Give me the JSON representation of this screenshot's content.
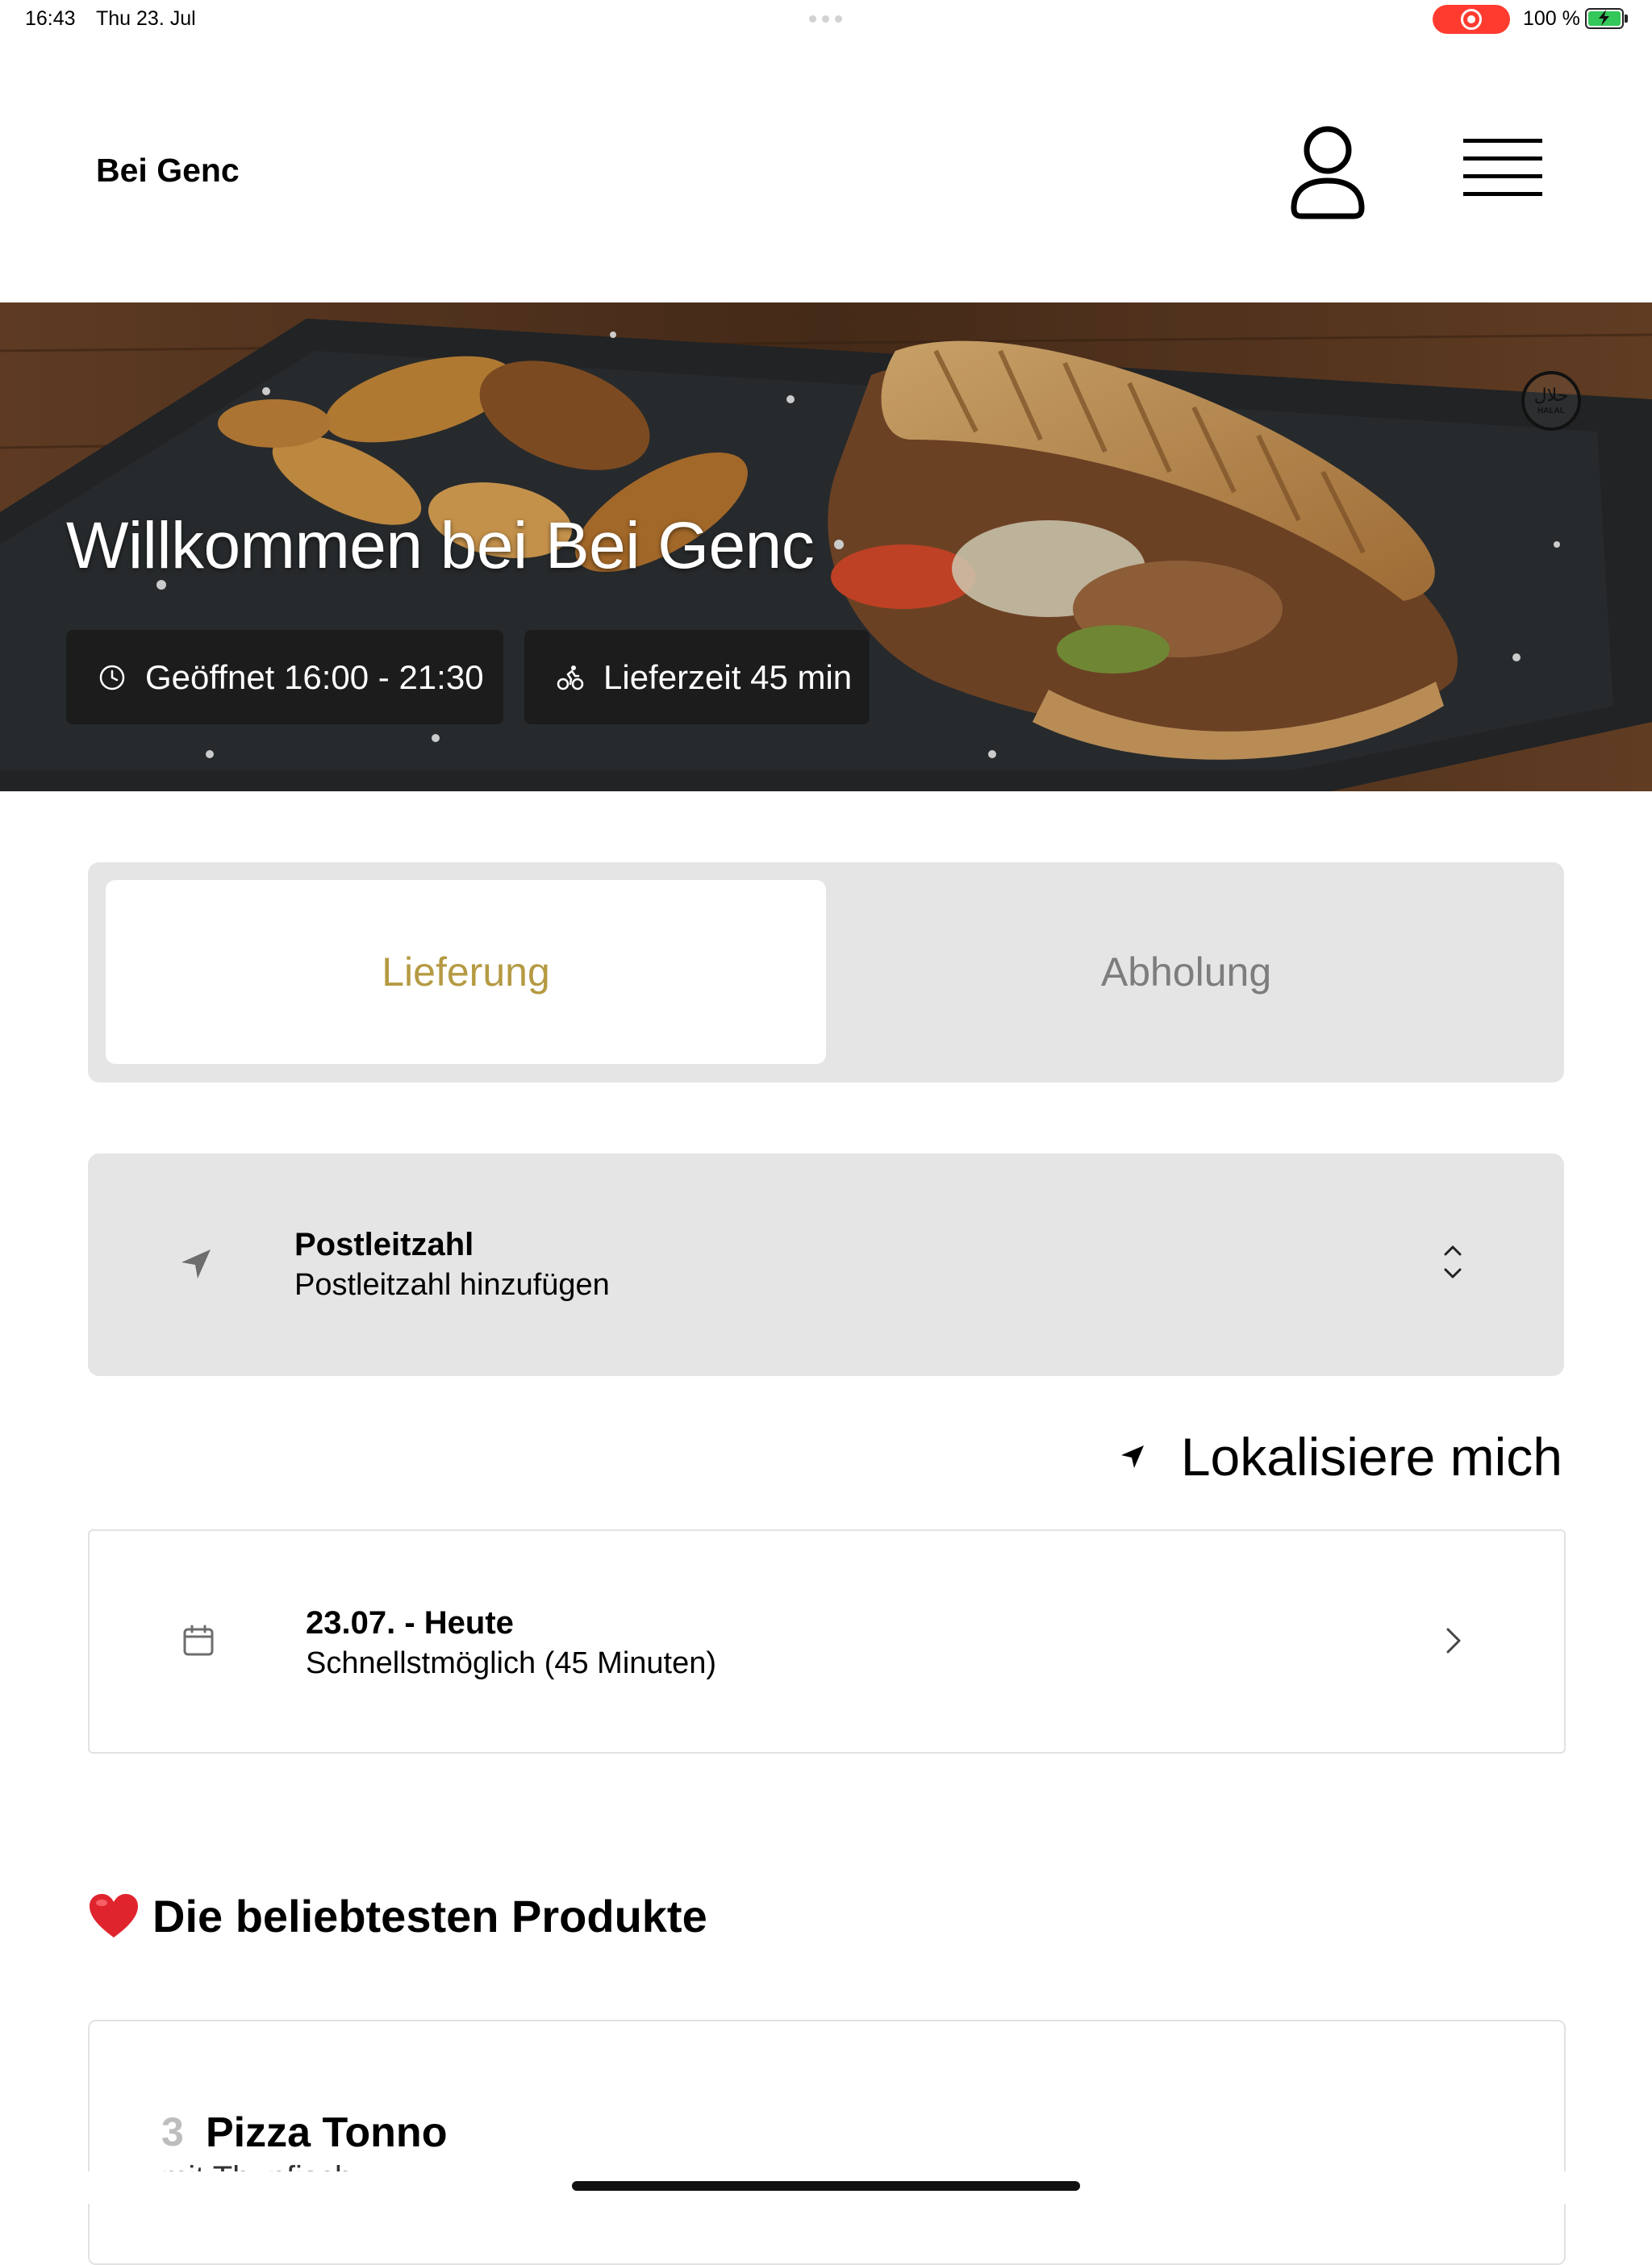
{
  "status_bar": {
    "time": "16:43",
    "date": "Thu 23. Jul",
    "battery_text": "100 %",
    "recording_color": "#ff3b30",
    "battery_color": "#34c759"
  },
  "header": {
    "title": "Bei Genc",
    "account_icon": "person-outline-icon",
    "menu_icon": "hamburger-menu-icon"
  },
  "hero": {
    "title": "Willkommen bei Bei Genc",
    "opening_hours": "Geöffnet 16:00 - 21:30",
    "delivery_time": "Lieferzeit 45 min",
    "badge_arabic": "حلال",
    "badge_latin": "HALAL"
  },
  "order_mode": {
    "options": [
      "Lieferung",
      "Abholung"
    ],
    "selected": "Lieferung",
    "accent_color": "#b59a43"
  },
  "postal_code": {
    "label": "Postleitzahl",
    "placeholder": "Postleitzahl hinzufügen"
  },
  "locate_me": {
    "label": "Lokalisiere mich"
  },
  "delivery_date": {
    "label": "23.07. - Heute",
    "value": "Schnellstmöglich (45 Minuten)"
  },
  "popular": {
    "heading": "Die beliebtesten Produkte",
    "products": [
      {
        "rank": "3",
        "name": "Pizza Tonno",
        "description": "mit Thunfisch"
      }
    ]
  }
}
